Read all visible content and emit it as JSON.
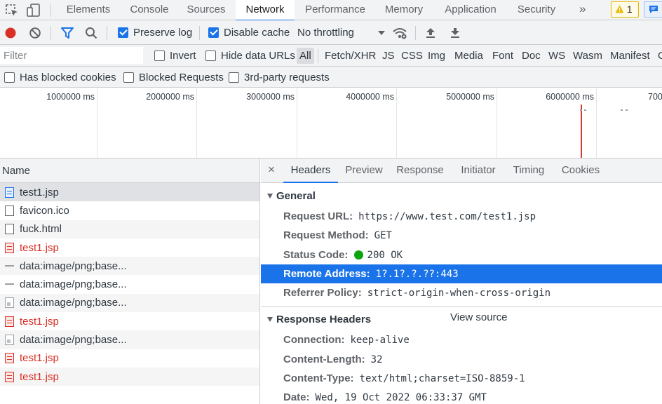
{
  "devtools": {
    "tabs": [
      {
        "label": "Elements"
      },
      {
        "label": "Console"
      },
      {
        "label": "Sources"
      },
      {
        "label": "Network"
      },
      {
        "label": "Performance"
      },
      {
        "label": "Memory"
      },
      {
        "label": "Application"
      },
      {
        "label": "Security"
      }
    ],
    "more_tabs": "»",
    "warnings_count": "1"
  },
  "toolbar": {
    "preserve_log": {
      "label": "Preserve log",
      "checked": true
    },
    "disable_cache": {
      "label": "Disable cache",
      "checked": true
    },
    "throttling": "No throttling"
  },
  "filter": {
    "placeholder": "Filter",
    "invert": "Invert",
    "hide_data_urls": "Hide data URLs",
    "types": [
      "All",
      "Fetch/XHR",
      "JS",
      "CSS",
      "Img",
      "Media",
      "Font",
      "Doc",
      "WS",
      "Wasm",
      "Manifest",
      "O"
    ],
    "active_type": "All",
    "has_blocked_cookies": "Has blocked cookies",
    "blocked_requests": "Blocked Requests",
    "third_party": "3rd-party requests"
  },
  "overview": {
    "ticks": [
      "1000000 ms",
      "2000000 ms",
      "3000000 ms",
      "4000000 ms",
      "5000000 ms",
      "6000000 ms",
      "700"
    ]
  },
  "requests": {
    "header": "Name",
    "rows": [
      {
        "name": "test1.jsp",
        "icon": "document-icon",
        "error": false,
        "selected": true
      },
      {
        "name": "favicon.ico",
        "icon": "document-icon",
        "error": false
      },
      {
        "name": "fuck.html",
        "icon": "document-icon",
        "error": false
      },
      {
        "name": "test1.jsp",
        "icon": "document-icon",
        "error": true
      },
      {
        "name": "data:image/png;base...",
        "icon": "image-icon",
        "error": false
      },
      {
        "name": "data:image/png;base...",
        "icon": "image-icon",
        "error": false
      },
      {
        "name": "data:image/png;base...",
        "icon": "image-icon",
        "error": false
      },
      {
        "name": "test1.jsp",
        "icon": "document-icon",
        "error": true
      },
      {
        "name": "data:image/png;base...",
        "icon": "image-icon",
        "error": false
      },
      {
        "name": "test1.jsp",
        "icon": "document-icon",
        "error": true
      },
      {
        "name": "test1.jsp",
        "icon": "document-icon",
        "error": true
      }
    ]
  },
  "details": {
    "close": "×",
    "tabs": [
      "Headers",
      "Preview",
      "Response",
      "Initiator",
      "Timing",
      "Cookies"
    ],
    "active_tab": "Headers",
    "general": {
      "title": "General",
      "request_url": {
        "key": "Request URL:",
        "value": "https://www.test.com/test1.jsp"
      },
      "request_method": {
        "key": "Request Method:",
        "value": "GET"
      },
      "status_code": {
        "key": "Status Code:",
        "value": "200 OK"
      },
      "remote_address": {
        "key": "Remote Address:",
        "value": "1?.1?.?.??:443"
      },
      "referrer_policy": {
        "key": "Referrer Policy:",
        "value": "strict-origin-when-cross-origin"
      }
    },
    "response_headers": {
      "title": "Response Headers",
      "view_source": "View source",
      "connection": {
        "key": "Connection:",
        "value": "keep-alive"
      },
      "content_length": {
        "key": "Content-Length:",
        "value": "32"
      },
      "content_type": {
        "key": "Content-Type:",
        "value": "text/html;charset=ISO-8859-1"
      },
      "date": {
        "key": "Date:",
        "value": "Wed, 19 Oct 2022 06:33:37 GMT"
      }
    }
  },
  "colors": {
    "accent": "#1a73e8",
    "error": "#d93025",
    "record": "#d93025",
    "status_ok": "#0ca40c"
  }
}
